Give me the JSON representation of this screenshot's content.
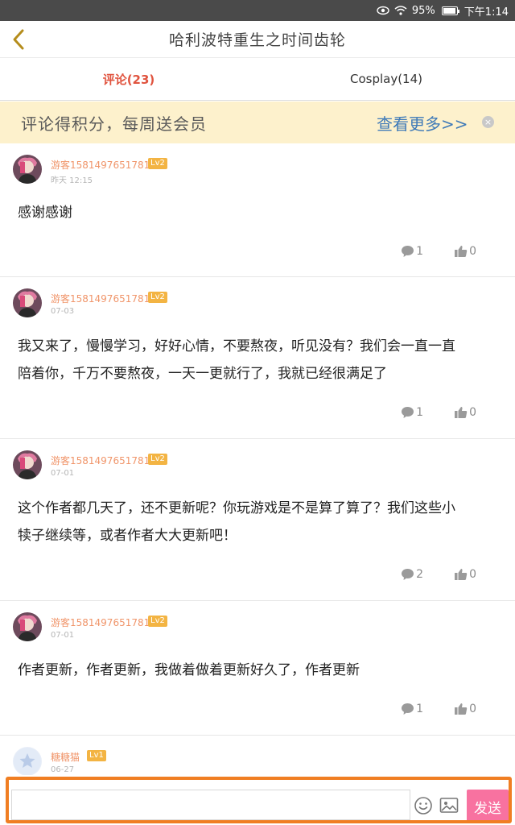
{
  "status_bar": {
    "battery": "95%",
    "time": "下午1:14",
    "battery_level": 0.95
  },
  "header": {
    "title": "哈利波特重生之时间齿轮",
    "back_icon": "chevron-left-icon"
  },
  "tabs": [
    {
      "label": "评论(23)",
      "active": true
    },
    {
      "label": "Cosplay(14)",
      "active": false
    }
  ],
  "banner": {
    "text": "评论得积分，每周送会员",
    "more": "查看更多>>"
  },
  "comments": [
    {
      "user": "游客1581497651781",
      "level": "Lv2",
      "time": "昨天 12:15",
      "text": [
        "感谢感谢"
      ],
      "replies": "1",
      "likes": "0"
    },
    {
      "user": "游客1581497651781",
      "level": "Lv2",
      "time": "07-03",
      "text": [
        "我又来了，慢慢学习，好好心情，不要熬夜，听见没有？我们会一直一直",
        "陪着你，千万不要熬夜，一天一更就行了，我就已经很满足了"
      ],
      "replies": "1",
      "likes": "0"
    },
    {
      "user": "游客1581497651781",
      "level": "Lv2",
      "time": "07-01",
      "text": [
        "这个作者都几天了，还不更新呢？你玩游戏是不是算了算了？我们这些小",
        "犊子继续等，或者作者大大更新吧！"
      ],
      "replies": "2",
      "likes": "0"
    },
    {
      "user": "游客1581497651781",
      "level": "Lv2",
      "time": "07-01",
      "text": [
        "作者更新，作者更新，我做着做着更新好久了，作者更新"
      ],
      "replies": "1",
      "likes": "0"
    },
    {
      "user": "糖糖猫",
      "level": "Lv1",
      "time": "06-27",
      "text": [],
      "replies": "",
      "likes": ""
    }
  ],
  "input": {
    "value": "",
    "placeholder": ""
  },
  "send_label": "发送",
  "colors": {
    "accent": "#e0543f",
    "username": "#f0956a",
    "level_badge": "#f3b443",
    "send": "#f872a0",
    "banner_bg": "#fdf1cc",
    "link": "#3f7ab8"
  }
}
